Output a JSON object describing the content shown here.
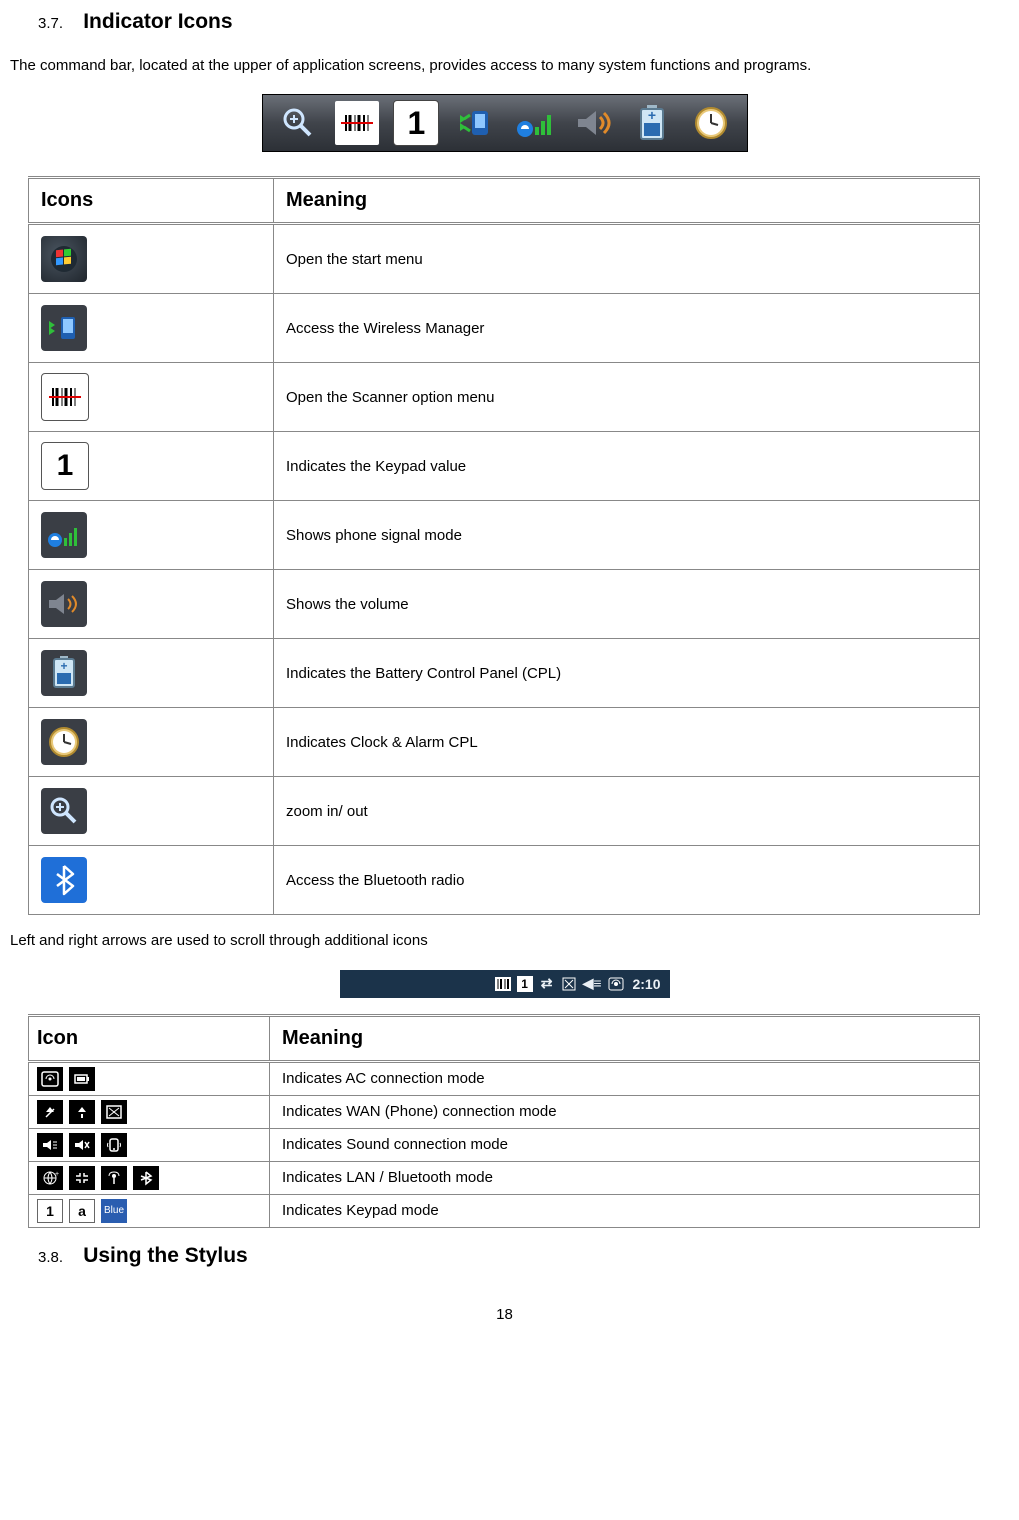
{
  "section1": {
    "num": "3.7.",
    "title": "Indicator Icons"
  },
  "intro": "The command bar, located at the upper of application screens, provides access to many system functions and programs.",
  "table1": {
    "h1": "Icons",
    "h2": "Meaning",
    "rows": [
      {
        "icon": "start",
        "meaning": "Open the start menu"
      },
      {
        "icon": "wireless",
        "meaning": "Access the Wireless Manager"
      },
      {
        "icon": "scanner",
        "meaning": "Open the Scanner option menu"
      },
      {
        "icon": "keypad",
        "meaning": "Indicates the Keypad value"
      },
      {
        "icon": "signal",
        "meaning": "Shows phone signal mode"
      },
      {
        "icon": "volume",
        "meaning": "Shows the volume"
      },
      {
        "icon": "battery",
        "meaning": "Indicates the Battery Control Panel (CPL)"
      },
      {
        "icon": "clock",
        "meaning": "Indicates Clock & Alarm CPL"
      },
      {
        "icon": "zoom",
        "meaning": "zoom in/ out"
      },
      {
        "icon": "bluetooth",
        "meaning": "Access the Bluetooth radio"
      }
    ]
  },
  "mid": "Left and right arrows are used to scroll through additional icons",
  "taskbar_time": "2:10",
  "table2": {
    "h1": "Icon",
    "h2": "Meaning",
    "rows": [
      {
        "meaning": "Indicates AC connection mode"
      },
      {
        "meaning": "Indicates WAN (Phone) connection mode"
      },
      {
        "meaning": "Indicates Sound connection mode"
      },
      {
        "meaning": "Indicates LAN / Bluetooth mode"
      },
      {
        "meaning": "Indicates Keypad mode"
      }
    ]
  },
  "section2": {
    "num": "3.8.",
    "title": "Using the Stylus"
  },
  "page": "18"
}
